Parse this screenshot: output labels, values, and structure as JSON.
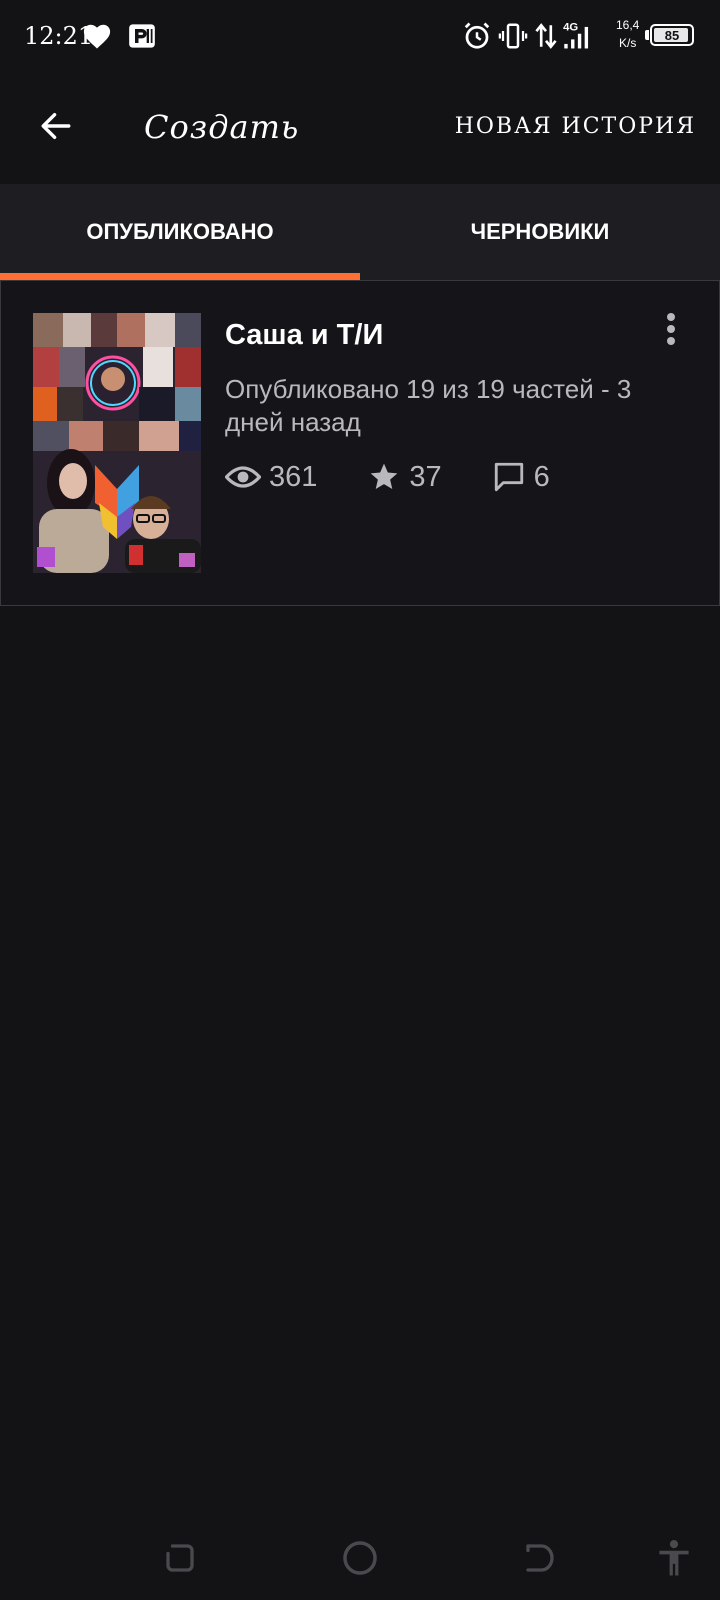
{
  "status_bar": {
    "time": "12:21",
    "net_speed_value": "16,4",
    "net_speed_unit": "K/s",
    "network_type": "4G",
    "battery_level": "85",
    "icons": [
      "heart-icon",
      "p-app-icon",
      "alarm-icon",
      "vibrate-icon",
      "data-transfer-icon",
      "signal-icon",
      "battery-icon"
    ]
  },
  "app_bar": {
    "title": "Создать",
    "action_label": "НОВАЯ ИСТОРИЯ"
  },
  "tabs": [
    {
      "label": "ОПУБЛИКОВАНО",
      "active": true
    },
    {
      "label": "ЧЕРНОВИКИ",
      "active": false
    }
  ],
  "stories": [
    {
      "title": "Саша и Т/И",
      "meta": "Опубликовано 19 из 19 частей - 3 дней назад",
      "views": "361",
      "votes": "37",
      "comments": "6"
    }
  ],
  "colors": {
    "background": "#131215",
    "tab_bar": "#1e1d21",
    "accent": "#ff6e33",
    "secondary_text": "#b9b8bc"
  },
  "nav_bar": {
    "icons": [
      "recent-apps-icon",
      "home-icon",
      "back-icon",
      "accessibility-icon"
    ]
  }
}
